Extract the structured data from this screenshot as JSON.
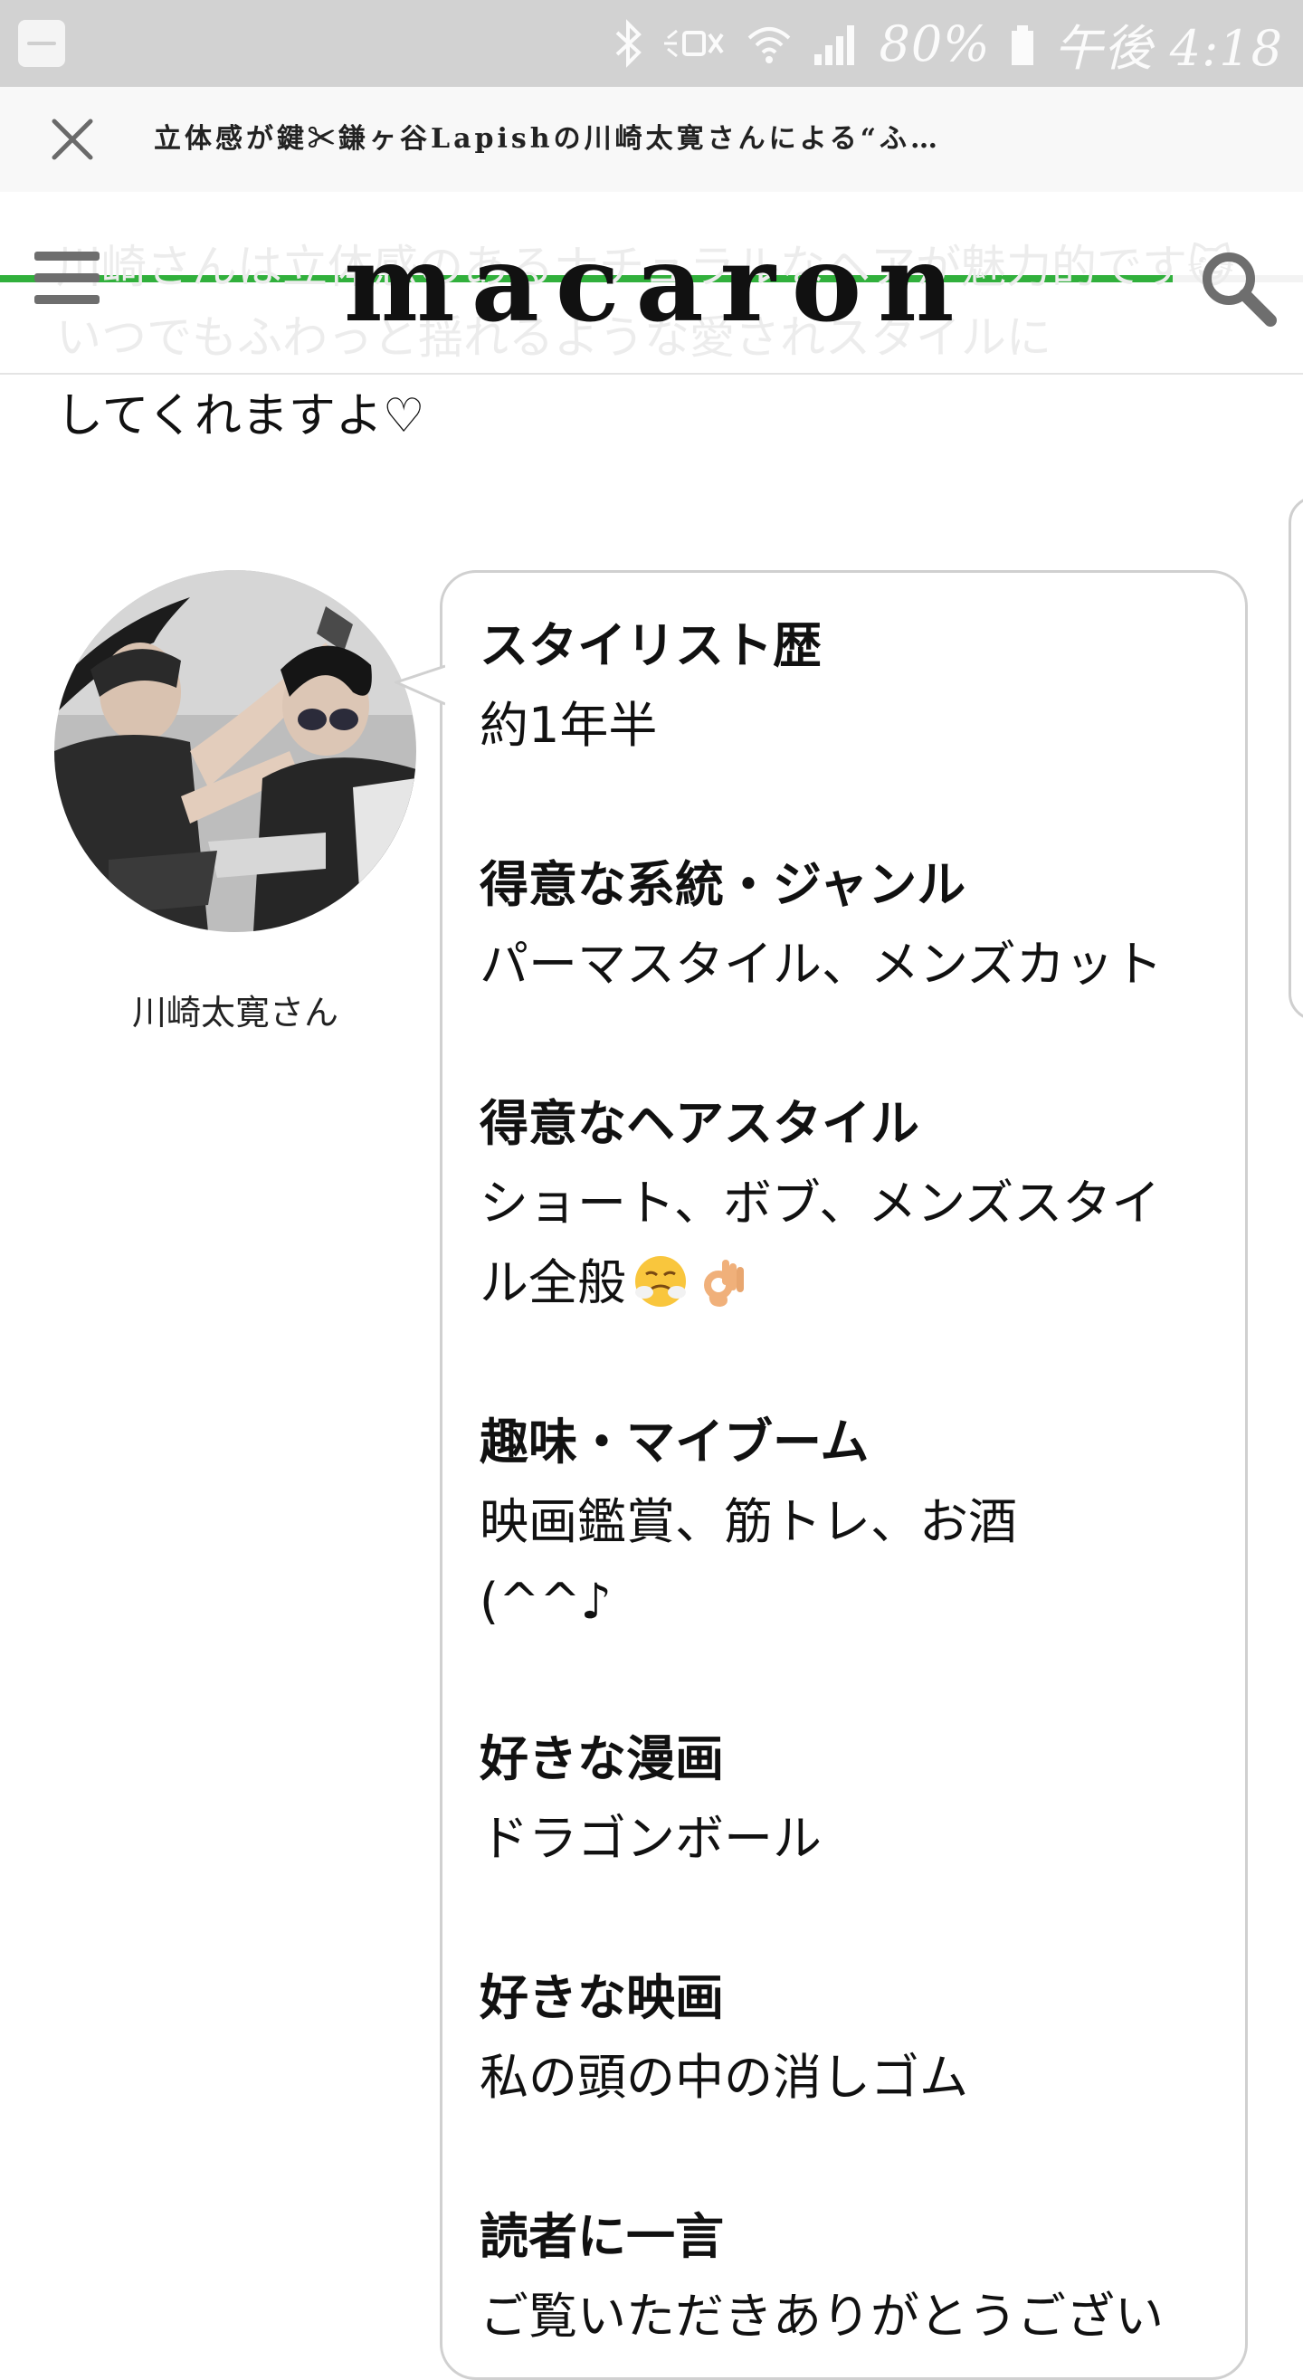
{
  "status_bar": {
    "battery_percent": "80%",
    "time": "午後 4:18",
    "icons": [
      "notification-app-icon",
      "bluetooth-icon",
      "mute-icon",
      "wifi-icon",
      "signal-icon",
      "battery-icon"
    ]
  },
  "sheet_header": {
    "title": "立体感が鍵✂鎌ヶ谷Lapishの川崎太寛さんによる“ふ…",
    "progress": 0.9
  },
  "nav": {
    "logo": "macaron",
    "ghost_text": "川崎さんは立体感のあるナチュラルなヘアが魅力的です😺いつでもふわっと揺れるような愛されスタイルに"
  },
  "article": {
    "intro_tail": "してくれますよ♡",
    "stylist_name": "川崎太寛さん",
    "qa": [
      {
        "q": "スタイリスト歴",
        "a": "約1年半"
      },
      {
        "q": "得意な系統・ジャンル",
        "a": "パーマスタイル、メンズカット"
      },
      {
        "q": "得意なヘアスタイル",
        "a_line1": "ショート、ボブ、メンズスタイ",
        "a_line2": "ル全般"
      },
      {
        "q": "趣味・マイブーム",
        "a_line1": "映画鑑賞、筋トレ、お酒",
        "a_line2": "(^^♪"
      },
      {
        "q": "好きな漫画",
        "a": "ドラゴンボール"
      },
      {
        "q": "好きな映画",
        "a": "私の頭の中の消しゴム"
      },
      {
        "q": "読者に一言",
        "a": "ご覧いただきありがとうござい"
      }
    ]
  },
  "colors": {
    "status_bar_bg": "#d2d2d2",
    "progress_green": "#31b03c",
    "icon_gray": "#6e6e6e",
    "bubble_border": "#d0d0d0"
  }
}
